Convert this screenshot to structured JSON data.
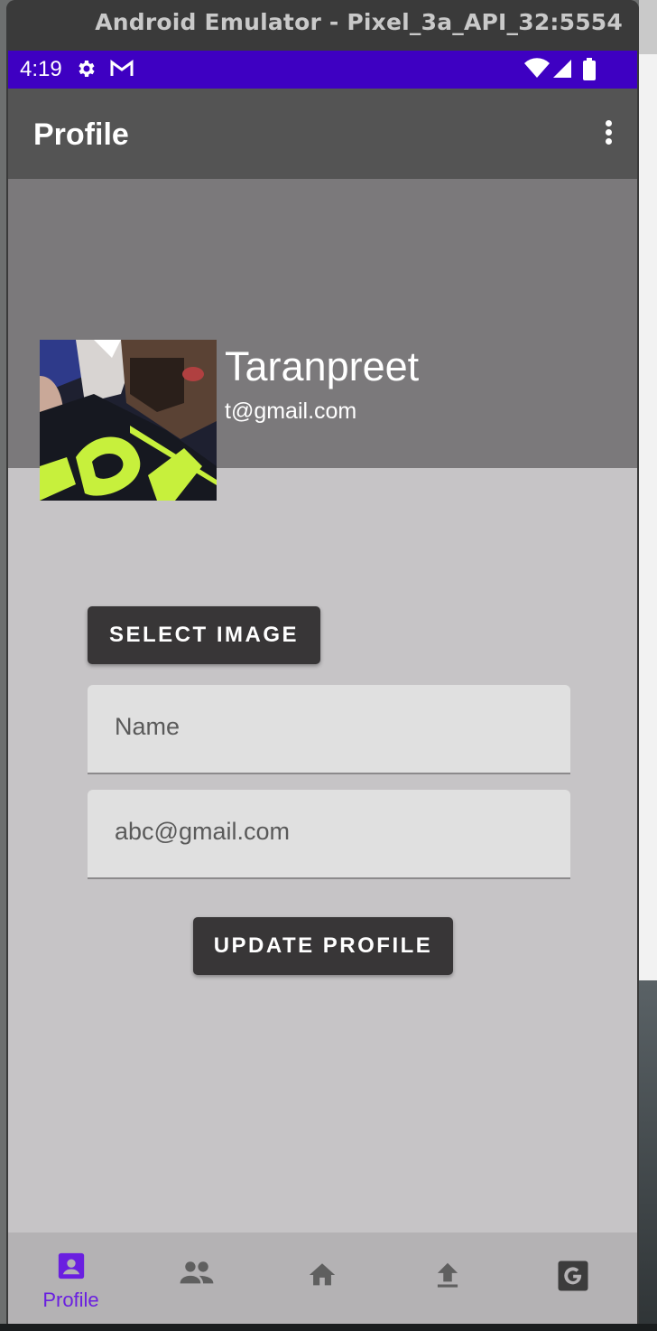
{
  "window": {
    "title": "Android Emulator - Pixel_3a_API_32:5554"
  },
  "status_bar": {
    "time": "4:19"
  },
  "app_bar": {
    "title": "Profile"
  },
  "profile": {
    "name": "Taranpreet",
    "email": "t@gmail.com"
  },
  "form": {
    "select_image_label": "SELECT IMAGE",
    "name_placeholder": "Name",
    "email_placeholder": "abc@gmail.com",
    "update_label": "UPDATE PROFILE"
  },
  "bottom_nav": {
    "items": [
      {
        "label": "Profile",
        "icon": "account-box-icon",
        "active": true
      },
      {
        "label": "",
        "icon": "people-icon",
        "active": false
      },
      {
        "label": "",
        "icon": "home-icon",
        "active": false
      },
      {
        "label": "",
        "icon": "upload-icon",
        "active": false
      },
      {
        "label": "",
        "icon": "google-icon",
        "active": false
      }
    ]
  },
  "colors": {
    "status_bar": "#3e00c2",
    "app_bar": "#545454",
    "header": "#7b797b",
    "content": "#c6c4c6",
    "button": "#383637",
    "nav_active": "#6a1fe0",
    "nav_inactive": "#5f5f5f"
  }
}
